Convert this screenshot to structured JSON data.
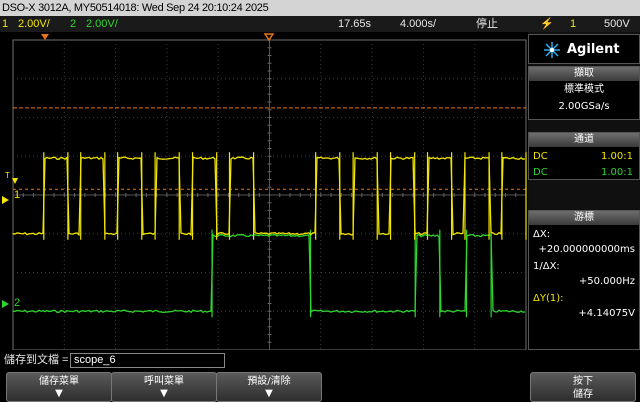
{
  "title": "DSO-X 3012A, MY50514018: Wed Sep 24 20:10:24 2025",
  "status": {
    "ch1_num": "1",
    "ch1_scale": "2.00V/",
    "ch2_num": "2",
    "ch2_scale": "2.00V/",
    "time_offset": "17.65s",
    "timebase": "4.000s/",
    "run_state": "停止",
    "trigger_icon": "⚡",
    "trigger_src": "1",
    "trigger_level": "500V"
  },
  "markers": {
    "ch1": "1",
    "ch2": "2",
    "trig_t": "T"
  },
  "panel": {
    "brand": "Agilent",
    "acq_header": "擷取",
    "acq_mode": "標準模式",
    "acq_rate": "2.00GSa/s",
    "chan_header": "通道",
    "chan1_coupling": "DC",
    "chan1_probe": "1.00:1",
    "chan2_coupling": "DC",
    "chan2_probe": "1.00:1",
    "cursor_header": "游標",
    "dx_label": "ΔX:",
    "dx_value": "+20.000000000ms",
    "inv_dx_label": "1/ΔX:",
    "inv_dx_value": "+50.000Hz",
    "dy_label": "ΔY(1):",
    "dy_value": "+4.14075V"
  },
  "file": {
    "label": "儲存到文檔 =",
    "value": "scope_6"
  },
  "softkeys": [
    {
      "label": "儲存菜單"
    },
    {
      "label": "呼叫菜單"
    },
    {
      "label": "預設/清除"
    },
    {
      "label": "按下"
    },
    {
      "label": "儲存"
    }
  ],
  "colors": {
    "ch1": "#f2e600",
    "ch2": "#2ed62e",
    "cursor": "#e8741a",
    "grid": "#3c3c3c"
  },
  "waveforms": {
    "ch1": {
      "high_v": 3.9,
      "low_v": 0.0,
      "pulses_div": [
        [
          0.6,
          1.07
        ],
        [
          1.32,
          1.79
        ],
        [
          2.04,
          2.51
        ],
        [
          2.77,
          3.24
        ],
        [
          3.5,
          3.97
        ],
        [
          4.22,
          4.69
        ],
        [
          5.9,
          6.37
        ],
        [
          6.63,
          7.1
        ],
        [
          7.36,
          7.83
        ],
        [
          8.08,
          8.55
        ],
        [
          8.81,
          9.28
        ],
        [
          9.53,
          10.0
        ]
      ]
    },
    "ch2": {
      "high_v": 3.9,
      "low_v": 0.0,
      "pulses_div": [
        [
          3.88,
          5.8
        ],
        [
          7.84,
          8.32
        ],
        [
          8.84,
          9.32
        ]
      ]
    }
  },
  "ref_levels": {
    "ch1_ref_div": 2.0,
    "ch2_ref_div": 6.0,
    "upper_cursor_v": 6.5,
    "lower_cursor_v": 2.3
  }
}
